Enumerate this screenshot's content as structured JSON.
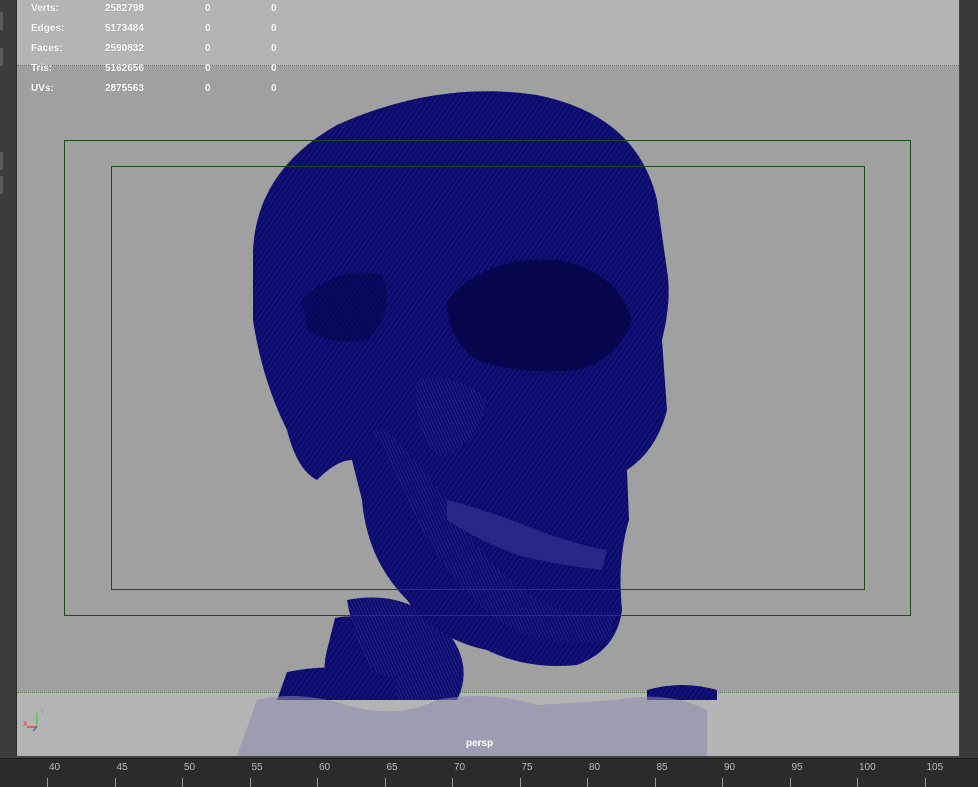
{
  "hud": {
    "rows": [
      {
        "label": "Verts:",
        "value": "2582798",
        "sel": "0",
        "comp": "0"
      },
      {
        "label": "Edges:",
        "value": "5173484",
        "sel": "0",
        "comp": "0"
      },
      {
        "label": "Faces:",
        "value": "2590832",
        "sel": "0",
        "comp": "0"
      },
      {
        "label": "Tris:",
        "value": "5162656",
        "sel": "0",
        "comp": "0"
      },
      {
        "label": "UVs:",
        "value": "2875563",
        "sel": "0",
        "comp": "0"
      }
    ]
  },
  "viewport": {
    "camera_label": "persp",
    "axis_labels": {
      "y": "Y",
      "x": "X"
    },
    "colors": {
      "wireframe": "#0b0b6e",
      "gate": "#1d4a1d",
      "background": "#a0a0a0",
      "hud_band": "#b4b4b4"
    }
  },
  "timeline": {
    "labels": [
      "40",
      "45",
      "50",
      "55",
      "60",
      "65",
      "70",
      "75",
      "80",
      "85",
      "90",
      "95",
      "100",
      "105"
    ]
  }
}
